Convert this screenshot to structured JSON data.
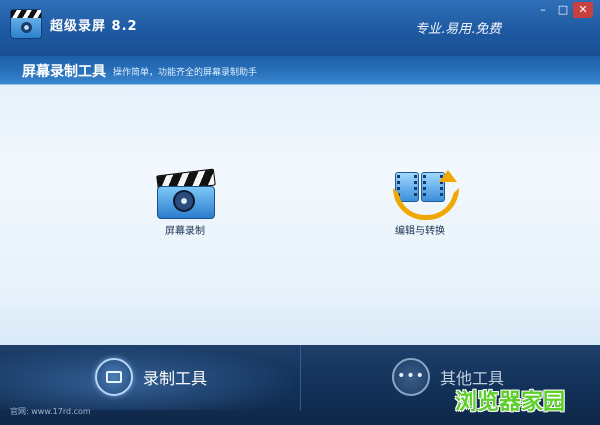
{
  "window": {
    "title": "超级录屏 8.2",
    "slogan": "专业.易用.免费",
    "controls": {
      "minimize": "–",
      "maximize": "□",
      "close": "✕"
    }
  },
  "header": {
    "title": "屏幕录制工具",
    "description": "操作简单，功能齐全的屏幕录制助手"
  },
  "tiles": [
    {
      "label": "屏幕录制",
      "icon": "camera-clapperboard-icon"
    },
    {
      "label": "编辑与转换",
      "icon": "film-convert-icon"
    }
  ],
  "bottom_tabs": [
    {
      "label": "录制工具",
      "icon": "film-icon",
      "active": true
    },
    {
      "label": "其他工具",
      "icon": "more-dots-icon",
      "active": false
    }
  ],
  "footer": {
    "website": "官网: www.17rd.com"
  },
  "watermark": "浏览器家园",
  "colors": {
    "titlebar": "#1e5aa2",
    "bottombar": "#13325a",
    "watermark": "#5ccf2a"
  }
}
